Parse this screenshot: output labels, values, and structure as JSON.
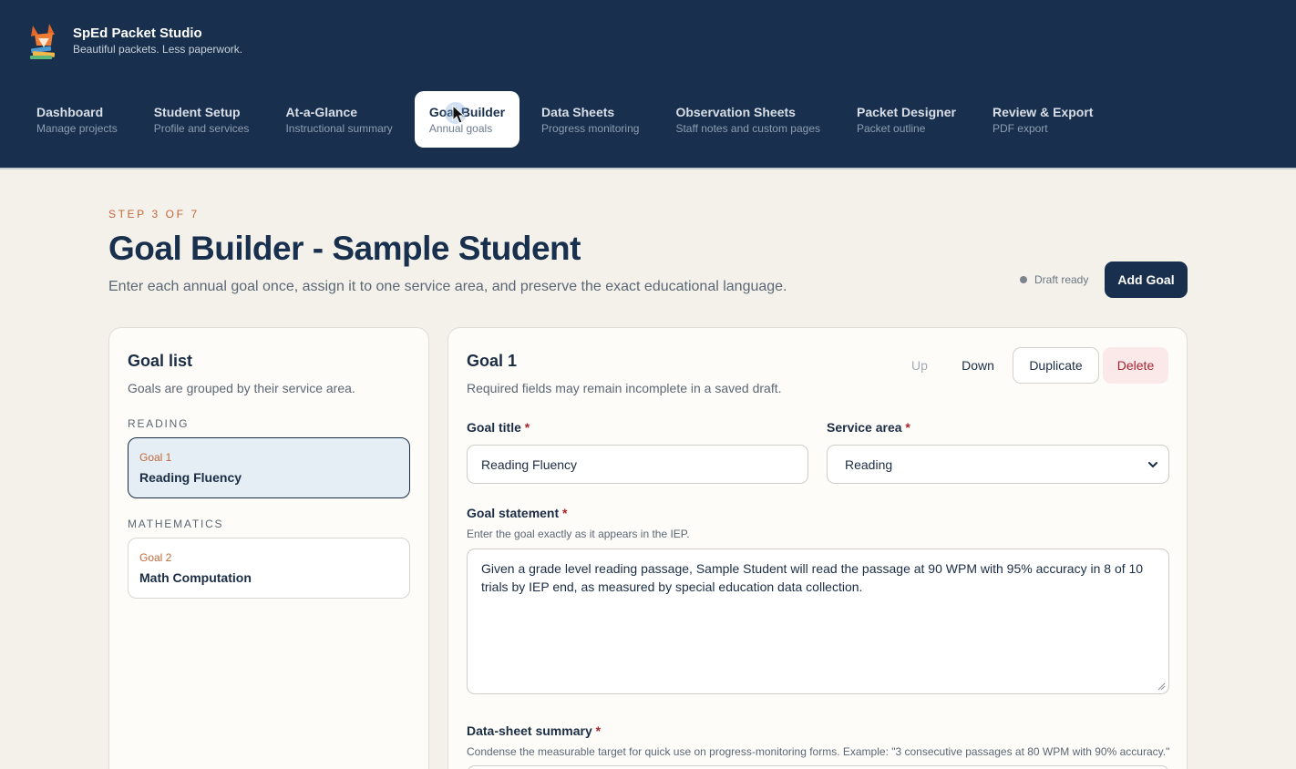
{
  "app": {
    "name": "SpEd Packet Studio",
    "tagline": "Beautiful packets. Less paperwork."
  },
  "nav": [
    {
      "label": "Dashboard",
      "sub": "Manage projects"
    },
    {
      "label": "Student Setup",
      "sub": "Profile and services"
    },
    {
      "label": "At-a-Glance",
      "sub": "Instructional summary"
    },
    {
      "label": "Goal Builder",
      "sub": "Annual goals",
      "active": true
    },
    {
      "label": "Data Sheets",
      "sub": "Progress monitoring"
    },
    {
      "label": "Observation Sheets",
      "sub": "Staff notes and custom pages"
    },
    {
      "label": "Packet Designer",
      "sub": "Packet outline"
    },
    {
      "label": "Review & Export",
      "sub": "PDF export"
    }
  ],
  "page": {
    "step": "STEP 3 OF 7",
    "title": "Goal Builder - Sample Student",
    "subtitle": "Enter each annual goal once, assign it to one service area, and preserve the exact educational language.",
    "status": "Draft ready",
    "add_goal_label": "Add Goal"
  },
  "goal_list": {
    "title": "Goal list",
    "description": "Goals are grouped by their service area.",
    "groups": [
      {
        "label": "READING",
        "goals": [
          {
            "number": "Goal 1",
            "name": "Reading Fluency",
            "selected": true
          }
        ]
      },
      {
        "label": "MATHEMATICS",
        "goals": [
          {
            "number": "Goal 2",
            "name": "Math Computation",
            "selected": false
          }
        ]
      }
    ]
  },
  "editor": {
    "title": "Goal 1",
    "description": "Required fields may remain incomplete in a saved draft.",
    "buttons": {
      "up": "Up",
      "down": "Down",
      "duplicate": "Duplicate",
      "delete": "Delete"
    },
    "required_mark": "*",
    "goal_title": {
      "label": "Goal title",
      "value": "Reading Fluency"
    },
    "service_area": {
      "label": "Service area",
      "value": "Reading"
    },
    "goal_statement": {
      "label": "Goal statement",
      "help": "Enter the goal exactly as it appears in the IEP.",
      "value": "Given a grade level reading passage, Sample Student will read the passage at 90 WPM with 95% accuracy in 8 of 10 trials by IEP end, as measured by special education data collection."
    },
    "data_sheet_summary": {
      "label": "Data-sheet summary",
      "help": "Condense the measurable target for quick use on progress-monitoring forms. Example: \"3 consecutive passages at 80 WPM with 90% accuracy.\""
    }
  },
  "colors": {
    "header_bg": "#18304d",
    "page_bg": "#f4f1eb",
    "accent": "#c0693a",
    "danger": "#a8232f",
    "selected_card_bg": "#e6eef5"
  }
}
